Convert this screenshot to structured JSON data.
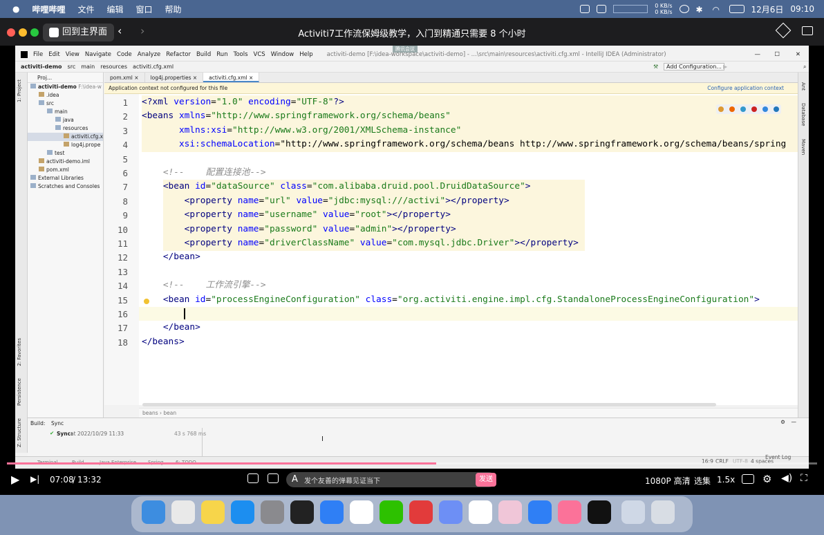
{
  "menubar": {
    "app": "哔哩哔哩",
    "items": [
      "文件",
      "编辑",
      "窗口",
      "帮助"
    ],
    "net_up": "0 KB/s",
    "net_down": "0 KB/s",
    "date": "12月6日",
    "time": "09:10"
  },
  "player": {
    "home_label": "回到主界面",
    "title": "Activiti7工作流保姆级教学，入门到精通只需要 8 个小时",
    "overlay_tag": "腾讯会议",
    "current_time": "07:08",
    "duration": "13:32",
    "progress": 0.53,
    "danmu_placeholder": "发个友善的弹幕见证当下",
    "send_label": "发送",
    "quality": "1080P 高清",
    "pick": "选集",
    "speed": "1.5x"
  },
  "ide": {
    "menu": [
      "File",
      "Edit",
      "View",
      "Navigate",
      "Code",
      "Analyze",
      "Refactor",
      "Build",
      "Run",
      "Tools",
      "VCS",
      "Window",
      "Help"
    ],
    "window_title": "activiti-demo [F:\\idea-workspace\\activiti-demo] - ...\\src\\main\\resources\\activiti.cfg.xml - IntelliJ IDEA (Administrator)",
    "breadcrumb_nav": [
      "activiti-demo",
      "src",
      "main",
      "resources",
      "activiti.cfg.xml"
    ],
    "add_config": "Add Configuration...",
    "project_header": "Proj...",
    "tree": [
      {
        "label": "activiti-demo",
        "note": "F:\\idea-w",
        "indent": 0
      },
      {
        "label": ".idea",
        "indent": 1
      },
      {
        "label": "src",
        "indent": 1
      },
      {
        "label": "main",
        "indent": 2
      },
      {
        "label": "java",
        "indent": 3
      },
      {
        "label": "resources",
        "indent": 3
      },
      {
        "label": "activiti.cfg.x",
        "indent": 4,
        "selected": true
      },
      {
        "label": "log4j.prope",
        "indent": 4
      },
      {
        "label": "test",
        "indent": 2
      },
      {
        "label": "activiti-demo.iml",
        "indent": 1
      },
      {
        "label": "pom.xml",
        "indent": 1
      },
      {
        "label": "External Libraries",
        "indent": 0
      },
      {
        "label": "Scratches and Consoles",
        "indent": 0
      }
    ],
    "tabs": [
      "pom.xml",
      "log4j.properties",
      "activiti.cfg.xml"
    ],
    "banner": "Application context not configured for this file",
    "banner_link": "Configure application context",
    "editor_crumbs": [
      "beans",
      "bean"
    ],
    "build_tab": "Build:",
    "sync_tab": "Sync",
    "sync_text": "Sync:",
    "sync_time": "at 2022/10/29 11:33",
    "sync_duration": "43 s 768 ms",
    "status": {
      "pos": "16:9",
      "eol": "CRLF",
      "enc": "UTF-8",
      "indent": "4 spaces",
      "event_log": "Event Log"
    },
    "bottom_tabs": [
      "Terminal",
      "Build",
      "Java Enterprise",
      "Spring",
      "6: TODO"
    ],
    "side_tabs": [
      "1: Project",
      "2: Favorites",
      "Persistence",
      "Z: Structure"
    ],
    "right_tabs": [
      "Ant",
      "Database",
      "Maven"
    ]
  },
  "code_lines": [
    {
      "n": "1",
      "t": "<?xml version=\"1.0\" encoding=\"UTF-8\"?>"
    },
    {
      "n": "2",
      "t": "<beans xmlns=\"http://www.springframework.org/schema/beans\""
    },
    {
      "n": "3",
      "t": "       xmlns:xsi=\"http://www.w3.org/2001/XMLSchema-instance\""
    },
    {
      "n": "4",
      "t": "       xsi:schemaLocation=\"http://www.springframework.org/schema/beans http://www.springframework.org/schema/beans/spring"
    },
    {
      "n": "5",
      "t": ""
    },
    {
      "n": "6",
      "t": "    <!--    配置连接池-->"
    },
    {
      "n": "7",
      "t": "    <bean id=\"dataSource\" class=\"com.alibaba.druid.pool.DruidDataSource\">"
    },
    {
      "n": "8",
      "t": "        <property name=\"url\" value=\"jdbc:mysql:///activi\"></property>"
    },
    {
      "n": "9",
      "t": "        <property name=\"username\" value=\"root\"></property>"
    },
    {
      "n": "10",
      "t": "        <property name=\"password\" value=\"admin\"></property>"
    },
    {
      "n": "11",
      "t": "        <property name=\"driverClassName\" value=\"com.mysql.jdbc.Driver\"></property>"
    },
    {
      "n": "12",
      "t": "    </bean>"
    },
    {
      "n": "13",
      "t": ""
    },
    {
      "n": "14",
      "t": "    <!--    工作流引擎-->"
    },
    {
      "n": "15",
      "t": "    <bean id=\"processEngineConfiguration\" class=\"org.activiti.engine.impl.cfg.StandaloneProcessEngineConfiguration\">"
    },
    {
      "n": "16",
      "t": ""
    },
    {
      "n": "17",
      "t": "    </bean>"
    },
    {
      "n": "18",
      "t": "</beans>"
    }
  ],
  "dock": [
    "finder",
    "launchpad",
    "notes",
    "app-store",
    "system-preferences",
    "terminal",
    "safari",
    "chrome",
    "wechat",
    "netease-music",
    "baidu-netdisk",
    "notchbar",
    "photos-app",
    "todo-app",
    "bilibili",
    "intellij-idea",
    "documents",
    "trash"
  ]
}
